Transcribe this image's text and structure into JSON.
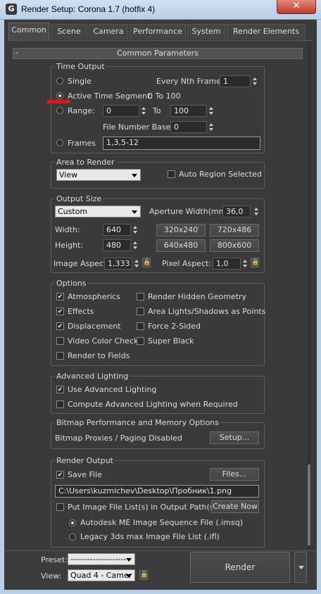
{
  "window": {
    "title": "Render Setup: Corona 1.7 (hotfix 4)",
    "app_icon": "G",
    "close_label": "✕"
  },
  "tabs": [
    {
      "label": "Common"
    },
    {
      "label": "Scene"
    },
    {
      "label": "Camera"
    },
    {
      "label": "Performance"
    },
    {
      "label": "System"
    },
    {
      "label": "Render Elements"
    }
  ],
  "rollout": {
    "title": "Common Parameters",
    "collapse": "-"
  },
  "time_output": {
    "label": "Time Output",
    "single": "Single",
    "every_nth_label": "Every Nth Frame:",
    "every_nth_value": "1",
    "active_segment": "Active Time Segment:",
    "active_segment_range": "0 To 100",
    "range": "Range:",
    "range_from": "0",
    "range_to_label": "To",
    "range_to": "100",
    "file_number_base_label": "File Number Base:",
    "file_number_base": "0",
    "frames": "Frames",
    "frames_value": "1,3,5-12"
  },
  "area_to_render": {
    "label": "Area to Render",
    "selected": "View",
    "auto_region": "Auto Region Selected"
  },
  "output_size": {
    "label": "Output Size",
    "preset": "Custom",
    "aperture_label": "Aperture Width(mm):",
    "aperture": "36,0",
    "width_label": "Width:",
    "width": "640",
    "height_label": "Height:",
    "height": "480",
    "presets": [
      "320x240",
      "720x486",
      "640x480",
      "800x600"
    ],
    "image_aspect_label": "Image Aspect:",
    "image_aspect": "1,333",
    "pixel_aspect_label": "Pixel Aspect:",
    "pixel_aspect": "1,0"
  },
  "options": {
    "label": "Options",
    "items": [
      {
        "label": "Atmospherics",
        "checked": "✔"
      },
      {
        "label": "Render Hidden Geometry",
        "checked": ""
      },
      {
        "label": "Effects",
        "checked": "✔"
      },
      {
        "label": "Area Lights/Shadows as Points",
        "checked": ""
      },
      {
        "label": "Displacement",
        "checked": "✔"
      },
      {
        "label": "Force 2-Sided",
        "checked": ""
      },
      {
        "label": "Video Color Check",
        "checked": ""
      },
      {
        "label": "Super Black",
        "checked": ""
      },
      {
        "label": "Render to Fields",
        "checked": ""
      }
    ]
  },
  "advanced_lighting": {
    "label": "Advanced Lighting",
    "use": "Use Advanced Lighting",
    "use_checked": "✔",
    "compute": "Compute Advanced Lighting when Required"
  },
  "bitmap": {
    "label": "Bitmap Performance and Memory Options",
    "status": "Bitmap Proxies / Paging Disabled",
    "setup": "Setup..."
  },
  "render_output": {
    "label": "Render Output",
    "save_file": "Save File",
    "save_checked": "✔",
    "files_button": "Files...",
    "path": "C:\\Users\\kuzmichev\\Desktop\\Пробник\\1.png",
    "put_list": "Put Image File List(s) in Output Path(s)",
    "create_now": "Create Now",
    "autodesk": "Autodesk ME Image Sequence File (.imsq)",
    "legacy": "Legacy 3ds max Image File List (.ifl)"
  },
  "footer": {
    "preset_label": "Preset:",
    "preset_value": "--------------------",
    "view_label": "View:",
    "view_value": "Quad 4 - Camer",
    "render": "Render"
  }
}
